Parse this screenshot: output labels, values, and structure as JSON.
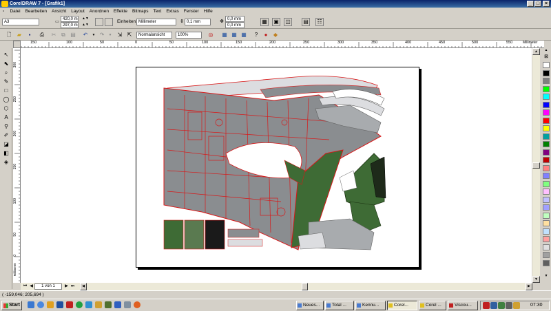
{
  "window": {
    "title": "CorelDRAW 7 - [Grafik1]",
    "min": "_",
    "max": "□",
    "close": "×"
  },
  "menu": [
    "Datei",
    "Bearbeiten",
    "Ansicht",
    "Layout",
    "Anordnen",
    "Effekte",
    "Bitmaps",
    "Text",
    "Extras",
    "Fenster",
    "Hilfe"
  ],
  "propbar": {
    "paper_size": "A3",
    "width": "420,0 m",
    "height": "297,0 m",
    "units_label": "Einheiten:",
    "units": "Millimeter",
    "nudge": "0,1 mm",
    "dup_x": "0,0 mm",
    "dup_y": "0,0 mm"
  },
  "stdbar": {
    "view_mode": "Normalansicht",
    "zoom": "100%"
  },
  "ruler": {
    "h_ticks": [
      "150",
      "100",
      "50",
      "0",
      "50",
      "100",
      "150",
      "200",
      "250",
      "300",
      "350",
      "400",
      "450",
      "500",
      "550"
    ],
    "h_unit": "Millimeter",
    "v_ticks": [
      "300",
      "250",
      "200",
      "150",
      "100",
      "50",
      "0"
    ],
    "v_unit": "Millimeter"
  },
  "page_nav": {
    "text": "1 von 1"
  },
  "status": {
    "coords": "( -159,046; 205,694 )"
  },
  "taskbar": {
    "start": "Start",
    "tasks": [
      "Neues...",
      "Total ...",
      "Kennu...",
      "Corel...",
      "Corel ...",
      "Viscou..."
    ],
    "active_index": 3,
    "clock": "07:30"
  },
  "palette": [
    "#ffffff",
    "#000000",
    "#7f7f7f",
    "#00ff00",
    "#00ffff",
    "#0000ff",
    "#ff00ff",
    "#ff0000",
    "#ffff00",
    "#00a0a0",
    "#008000",
    "#800080",
    "#c00000",
    "#ff8080",
    "#8080ff",
    "#80ff80",
    "#ffc0ff",
    "#c0c0ff",
    "#a0a0ff",
    "#c0ffc0",
    "#ffe0a0",
    "#c0e0ff",
    "#ffa0a0",
    "#e0e0e0",
    "#a0a0a0",
    "#606060"
  ],
  "colors": {
    "titlebar": "#0a246a",
    "model_grey": "#8a8d90",
    "model_green": "#3e6b35",
    "outline_red": "#d81818"
  }
}
